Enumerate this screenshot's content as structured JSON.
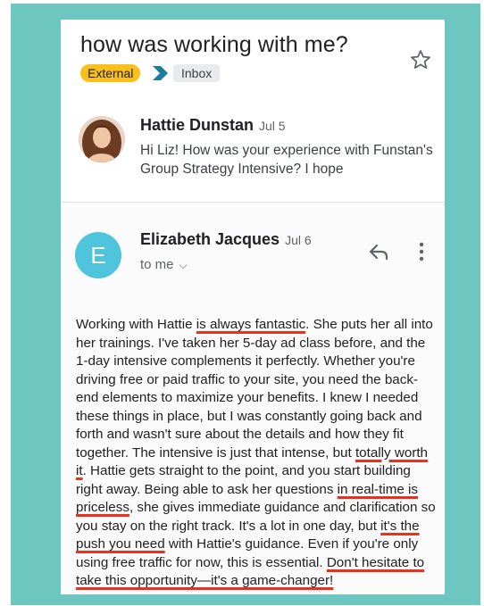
{
  "email": {
    "subject": "how was working with me?",
    "labels": {
      "external": "External",
      "inbox": "Inbox"
    },
    "first_message": {
      "sender": "Hattie Dunstan",
      "date": "Jul 5",
      "snippet": "Hi Liz! How was your experience with Funstan's Group Strategy Intensive? I hope"
    },
    "second_message": {
      "sender": "Elizabeth Jacques",
      "avatar_letter": "E",
      "date": "Jul 6",
      "recipient": "to me",
      "body": [
        "Working with Hattie ",
        "is always fantastic",
        ". She puts her all into her trainings. I've taken her 5-day ad class before, and the 1-day intensive complements it perfectly. Whether you're driving free or paid traffic to your site, you need the back-end elements to maximize your benefits. I knew I needed these things in place, but I was constantly going back and forth and wasn't sure about the details and how they fit together. The intensive is just that intense, but ",
        "totally worth it",
        ". Hattie gets straight to the point, and you start building right away. Being able to ask her questions ",
        "in real-time is priceless",
        ", she gives immediate guidance and clarification so you stay on the right track. It's a lot in one day, but ",
        "it's the push you need",
        " with Hattie's guidance. Even if you're only using free traffic for now, this is essential. ",
        "Don't hesitate to take this opportunity—it's a game-changer!"
      ]
    }
  },
  "colors": {
    "frame": "#6ec6c0",
    "external_chip": "#f9c01b",
    "inbox_chevron": "#1a7f9c",
    "avatar_letter_bg": "#4ec4dd",
    "underline": "#e53320"
  },
  "icons": {
    "star": "star-icon",
    "reply": "reply-icon",
    "more": "more-vert-icon",
    "expand": "chevron-down-icon",
    "label_arrow": "label-chevron-icon"
  }
}
